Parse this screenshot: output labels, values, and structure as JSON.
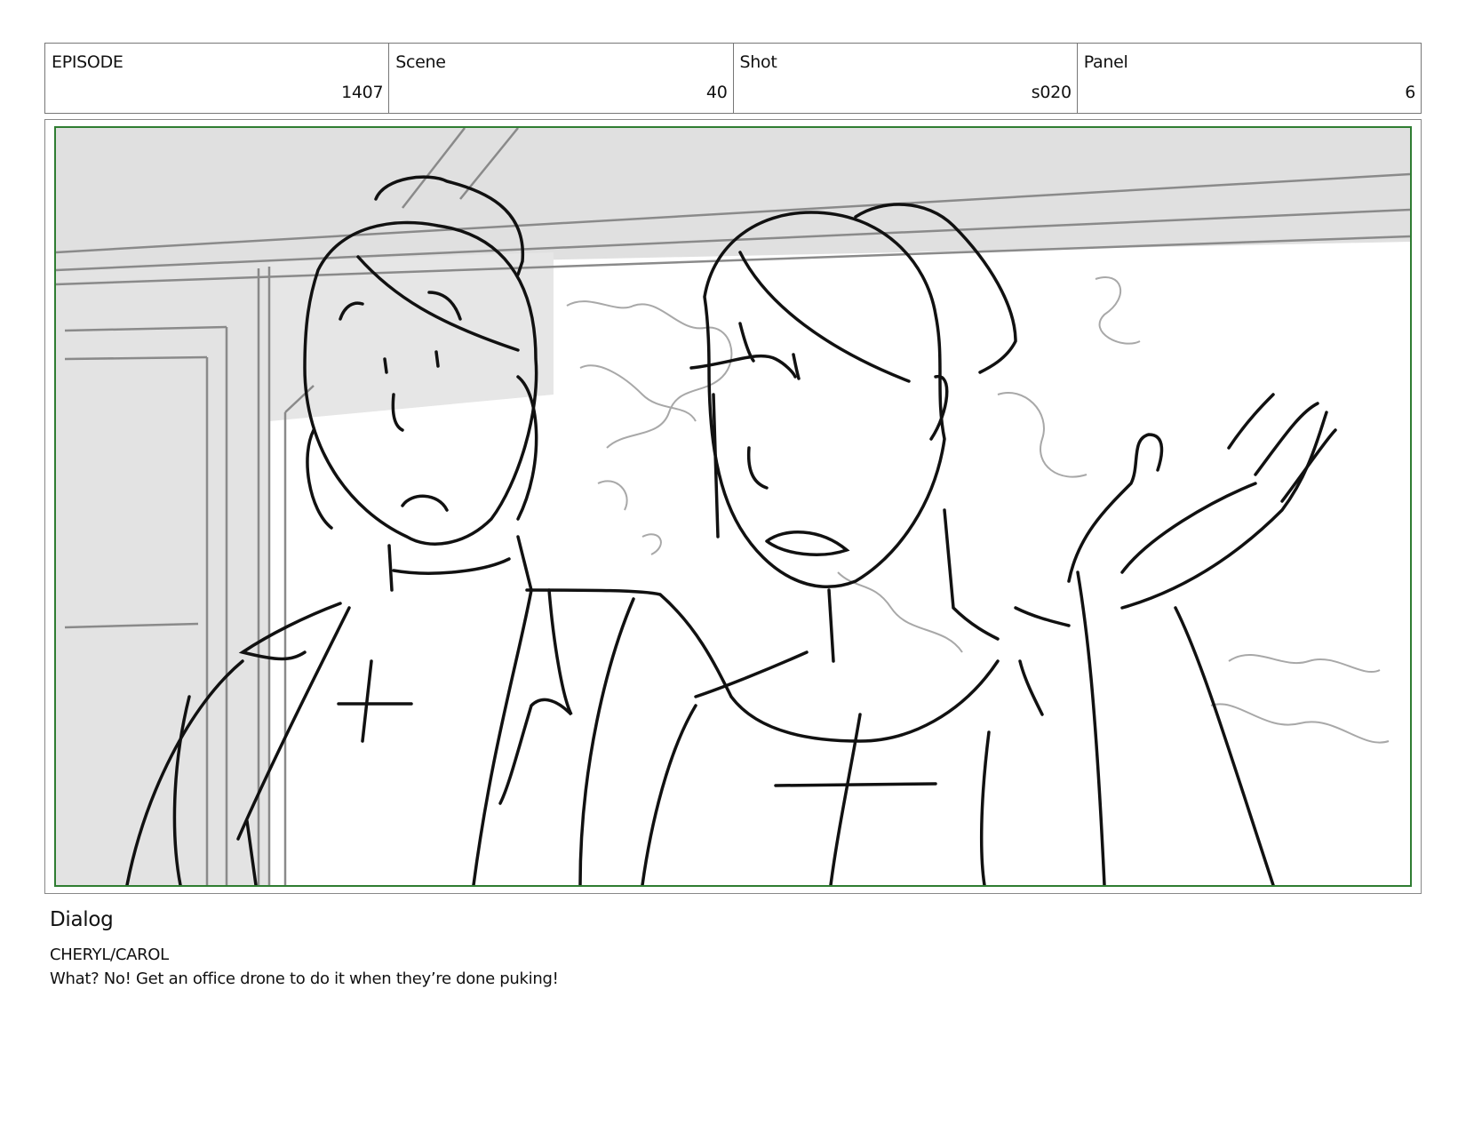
{
  "header": {
    "episode": {
      "label": "EPISODE",
      "value": "1407"
    },
    "scene": {
      "label": "Scene",
      "value": "40"
    },
    "shot": {
      "label": "Shot",
      "value": "s020"
    },
    "panel": {
      "label": "Panel",
      "value": "6"
    }
  },
  "dialog": {
    "heading": "Dialog",
    "speaker": "CHERYL/CAROL",
    "line": "What? No! Get an office drone to do it when they’re done puking!"
  },
  "colors": {
    "frame_border": "#2f7d32",
    "ink": "#111111",
    "background_tone": "#e2e2e2"
  }
}
